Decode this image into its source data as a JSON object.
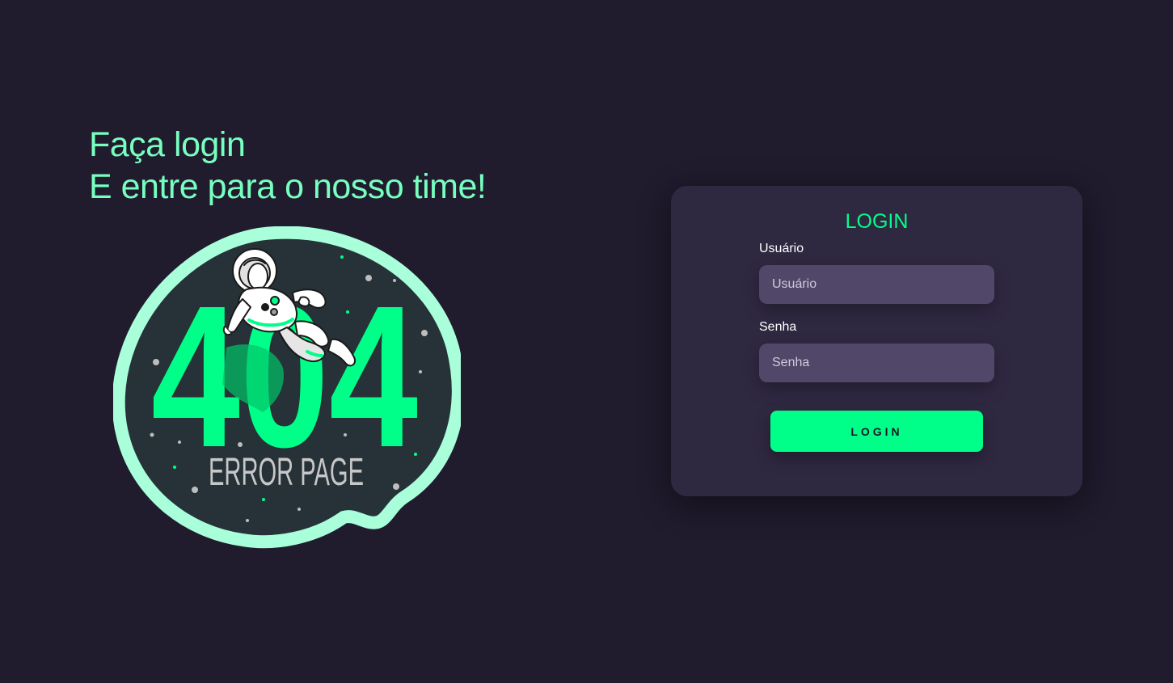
{
  "hero": {
    "line1": "Faça login",
    "line2": "E entre para o nosso time!"
  },
  "illustration": {
    "big_text": "404",
    "caption": "ERROR PAGE",
    "colors": {
      "blob_border": "#a8ffd9",
      "blob_fill": "#263238",
      "digits": "#00ff88",
      "caption": "#c7c7c7"
    }
  },
  "login_card": {
    "title": "LOGIN",
    "username": {
      "label": "Usuário",
      "placeholder": "Usuário",
      "value": ""
    },
    "password": {
      "label": "Senha",
      "placeholder": "Senha",
      "value": ""
    },
    "submit_label": "LOGIN"
  },
  "theme": {
    "background": "#201b2d",
    "card": "#2f2841",
    "input": "#514869",
    "accent": "#00ff88",
    "hero_text": "#77ffc0"
  }
}
